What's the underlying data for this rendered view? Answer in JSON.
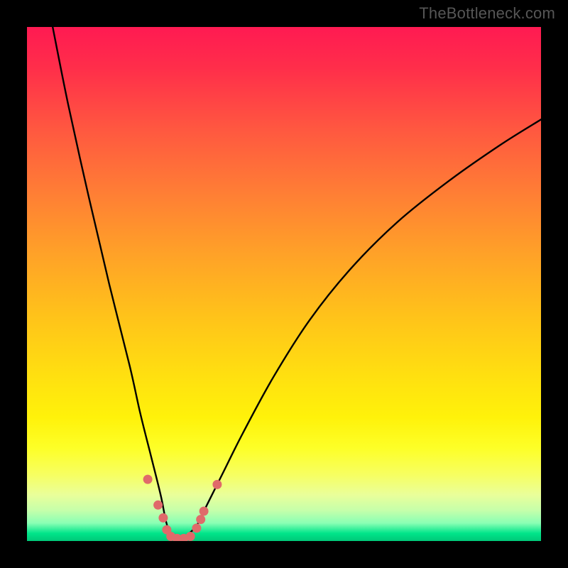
{
  "watermark": "TheBottleneck.com",
  "colors": {
    "frame": "#000000",
    "curve": "#000000",
    "markers": "#e06a6a",
    "gradient_stops": [
      "#ff1a52",
      "#ff2e4a",
      "#ff5840",
      "#ff7d35",
      "#ffa128",
      "#ffc21a",
      "#ffe010",
      "#fff20a",
      "#fdff28",
      "#f7ff60",
      "#eaff9a",
      "#c6ffaa",
      "#8affb4",
      "#00e58a",
      "#00c878"
    ]
  },
  "chart_data": {
    "type": "line",
    "title": "",
    "xlabel": "",
    "ylabel": "",
    "xlim": [
      0,
      100
    ],
    "ylim": [
      0,
      100
    ],
    "series": [
      {
        "name": "bottleneck-curve",
        "x": [
          5,
          8,
          12,
          16,
          20,
          22,
          24,
          26,
          27,
          28,
          29,
          30,
          31,
          33,
          35,
          38,
          42,
          48,
          55,
          63,
          72,
          82,
          92,
          100
        ],
        "y": [
          100,
          85,
          67,
          50,
          34,
          25,
          17,
          9,
          4,
          1,
          0,
          0,
          1,
          3,
          7,
          13,
          21,
          32,
          43,
          53,
          62,
          70,
          77,
          82
        ]
      }
    ],
    "markers": [
      {
        "name": "marker",
        "x": 23.5,
        "y": 12.0
      },
      {
        "name": "marker",
        "x": 25.5,
        "y": 7.0
      },
      {
        "name": "marker",
        "x": 26.5,
        "y": 4.5
      },
      {
        "name": "marker",
        "x": 27.2,
        "y": 2.2
      },
      {
        "name": "marker",
        "x": 28.0,
        "y": 0.9
      },
      {
        "name": "marker",
        "x": 29.2,
        "y": 0.5
      },
      {
        "name": "marker",
        "x": 30.5,
        "y": 0.5
      },
      {
        "name": "marker",
        "x": 31.8,
        "y": 0.9
      },
      {
        "name": "marker",
        "x": 33.0,
        "y": 2.5
      },
      {
        "name": "marker",
        "x": 33.8,
        "y": 4.2
      },
      {
        "name": "marker",
        "x": 34.4,
        "y": 5.8
      },
      {
        "name": "marker",
        "x": 37.0,
        "y": 11.0
      }
    ]
  }
}
